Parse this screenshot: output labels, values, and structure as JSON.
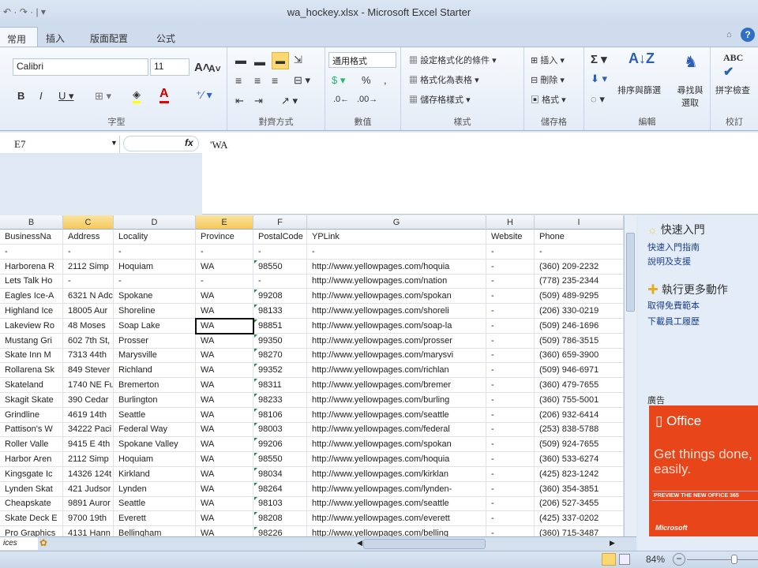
{
  "window": {
    "title": "wa_hockey.xlsx - Microsoft Excel Starter",
    "qat": "↶ · ↷ · | ▾"
  },
  "tabs": [
    "常用",
    "插入",
    "版面配置",
    "公式"
  ],
  "ribbon": {
    "font_name": "Calibri",
    "font_size": "11",
    "group_font": "字型",
    "group_align": "對齊方式",
    "number_format": "通用格式",
    "group_number": "數值",
    "cond_format": "設定格式化的條件 ▾",
    "format_table": "格式化為表格 ▾",
    "cell_styles": "儲存格樣式 ▾",
    "group_styles": "樣式",
    "insert": "插入 ▾",
    "delete": "刪除 ▾",
    "format": "格式 ▾",
    "group_cells": "儲存格",
    "sort_filter": "排序與篩選",
    "find_select": "尋找與選取",
    "group_editing": "編輯",
    "spelling": "拼字檢查",
    "group_proof": "校訂"
  },
  "formula_bar": {
    "cell_ref": "E7",
    "fx": "fx",
    "value": "'WA"
  },
  "columns": [
    "B",
    "C",
    "D",
    "E",
    "F",
    "G",
    "H",
    "I"
  ],
  "selected_column": "E",
  "rows": [
    [
      "BusinessNa",
      "Address",
      "Locality",
      "Province",
      "PostalCode",
      "YPLink",
      "Website",
      "Phone"
    ],
    [
      "-",
      "-",
      "-",
      "-",
      "-",
      "-",
      "-",
      "-"
    ],
    [
      "Harborena R",
      "2112 Simp",
      "Hoquiam",
      "WA",
      "98550",
      "http://www.yellowpages.com/hoquia",
      "-",
      "(360) 209-2232"
    ],
    [
      "Lets Talk Ho",
      "-",
      "-",
      "-",
      "-",
      "http://www.yellowpages.com/nation",
      "-",
      "(778) 235-2344"
    ],
    [
      "Eagles Ice-A",
      "6321 N Adc",
      "Spokane",
      "WA",
      "99208",
      "http://www.yellowpages.com/spokan",
      "-",
      "(509) 489-9295"
    ],
    [
      "Highland Ice",
      "18005 Aur",
      "Shoreline",
      "WA",
      "98133",
      "http://www.yellowpages.com/shoreli",
      "-",
      "(206) 330-0219"
    ],
    [
      "Lakeview Ro",
      "48 Moses",
      "Soap Lake",
      "WA",
      "98851",
      "http://www.yellowpages.com/soap-la",
      "-",
      "(509) 246-1696"
    ],
    [
      "Mustang Gri",
      "602 7th St,",
      "Prosser",
      "WA",
      "99350",
      "http://www.yellowpages.com/prosser",
      "-",
      "(509) 786-3515"
    ],
    [
      "Skate Inn M",
      "7313 44th",
      "Marysville",
      "WA",
      "98270",
      "http://www.yellowpages.com/marysvi",
      "-",
      "(360) 659-3900"
    ],
    [
      "Rollarena Sk",
      "849 Stever",
      "Richland",
      "WA",
      "99352",
      "http://www.yellowpages.com/richlan",
      "-",
      "(509) 946-6971"
    ],
    [
      "Skateland",
      "1740 NE Fu",
      "Bremerton",
      "WA",
      "98311",
      "http://www.yellowpages.com/bremer",
      "-",
      "(360) 479-7655"
    ],
    [
      "Skagit Skate",
      "390 Cedar",
      "Burlington",
      "WA",
      "98233",
      "http://www.yellowpages.com/burling",
      "-",
      "(360) 755-5001"
    ],
    [
      "Grindline",
      "4619 14th",
      "Seattle",
      "WA",
      "98106",
      "http://www.yellowpages.com/seattle",
      "-",
      "(206) 932-6414"
    ],
    [
      "Pattison's W",
      "34222 Paci",
      "Federal Way",
      "WA",
      "98003",
      "http://www.yellowpages.com/federal",
      "-",
      "(253) 838-5788"
    ],
    [
      "Roller Valle",
      "9415 E 4th",
      "Spokane Valley",
      "WA",
      "99206",
      "http://www.yellowpages.com/spokan",
      "-",
      "(509) 924-7655"
    ],
    [
      "Harbor Aren",
      "2112 Simp",
      "Hoquiam",
      "WA",
      "98550",
      "http://www.yellowpages.com/hoquia",
      "-",
      "(360) 533-6274"
    ],
    [
      "Kingsgate Ic",
      "14326 124t",
      "Kirkland",
      "WA",
      "98034",
      "http://www.yellowpages.com/kirklan",
      "-",
      "(425) 823-1242"
    ],
    [
      "Lynden Skat",
      "421 Judsor",
      "Lynden",
      "WA",
      "98264",
      "http://www.yellowpages.com/lynden-",
      "-",
      "(360) 354-3851"
    ],
    [
      "Cheapskate",
      "9891 Auror",
      "Seattle",
      "WA",
      "98103",
      "http://www.yellowpages.com/seattle",
      "-",
      "(206) 527-3455"
    ],
    [
      "Skate Deck E",
      "9700 19th",
      "Everett",
      "WA",
      "98208",
      "http://www.yellowpages.com/everett",
      "-",
      "(425) 337-0202"
    ],
    [
      "Pro Graphics",
      "4131 Hann",
      "Bellingham",
      "WA",
      "98226",
      "http://www.yellowpages.com/belling",
      "-",
      "(360) 715-3487"
    ]
  ],
  "pane": {
    "getting_started": "快速入門",
    "gs_guide": "快速入門指南",
    "help": "說明及支援",
    "more_actions": "執行更多動作",
    "templates": "取得免費範本",
    "download": "下載員工履歷",
    "ad_label": "廣告",
    "ad": {
      "brand": "Office",
      "headline": "Get things done, easily.",
      "cta": "PREVIEW THE NEW OFFICE 365",
      "footer": "Microsoft"
    }
  },
  "sheet_tab": "ices",
  "status": {
    "zoom": "84%"
  }
}
